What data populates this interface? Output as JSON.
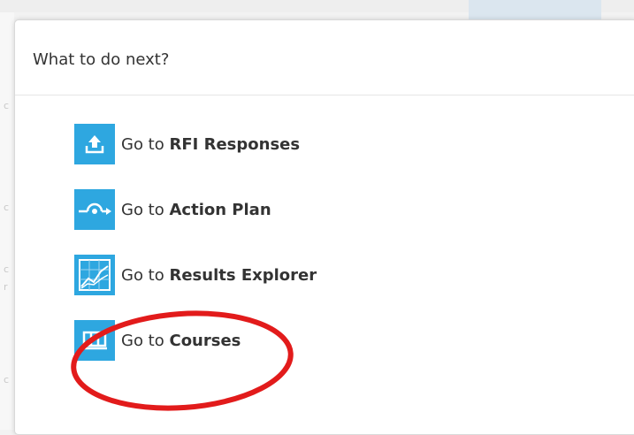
{
  "modal": {
    "title": "What to do next?"
  },
  "actions": [
    {
      "prefix": "Go to ",
      "target": "RFI Responses",
      "icon": "upload-icon"
    },
    {
      "prefix": "Go to ",
      "target": "Action Plan",
      "icon": "action-plan-icon"
    },
    {
      "prefix": "Go to ",
      "target": "Results Explorer",
      "icon": "chart-icon"
    },
    {
      "prefix": "Go to ",
      "target": "Courses",
      "icon": "courses-icon"
    }
  ],
  "colors": {
    "icon_bg": "#2ea7e0",
    "highlight": "#e21b1b",
    "title_text": "#333333"
  }
}
